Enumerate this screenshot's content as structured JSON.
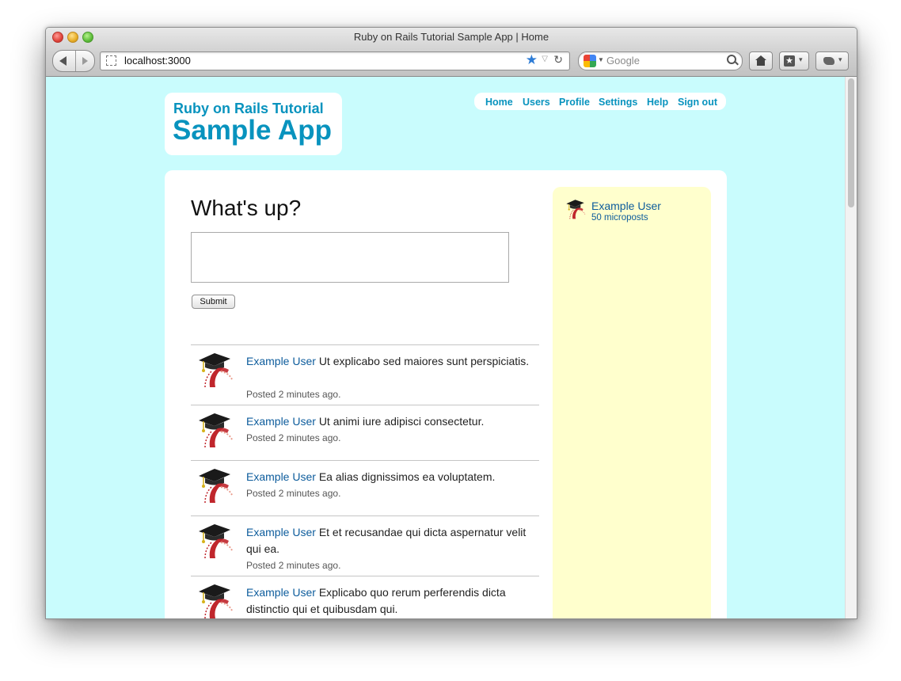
{
  "browser": {
    "window_title": "Ruby on Rails Tutorial Sample App | Home",
    "url": "localhost:3000",
    "search_placeholder": "Google"
  },
  "header": {
    "logo_small": "Ruby on Rails Tutorial",
    "logo_big": "Sample App",
    "nav": [
      "Home",
      "Users",
      "Profile",
      "Settings",
      "Help",
      "Sign out"
    ]
  },
  "compose": {
    "heading": "What's up?",
    "submit_label": "Submit"
  },
  "sidebar": {
    "user_name": "Example User",
    "microposts": "50 microposts"
  },
  "feed": [
    {
      "user": "Example User",
      "content": "Ut explicabo sed maiores sunt perspiciatis.",
      "posted": "Posted 2 minutes ago."
    },
    {
      "user": "Example User",
      "content": "Ut animi iure adipisci consectetur.",
      "posted": "Posted 2 minutes ago."
    },
    {
      "user": "Example User",
      "content": "Ea alias dignissimos ea voluptatem.",
      "posted": "Posted 2 minutes ago."
    },
    {
      "user": "Example User",
      "content": "Et et recusandae qui dicta aspernatur velit qui ea.",
      "posted": "Posted 2 minutes ago."
    },
    {
      "user": "Example User",
      "content": "Explicabo quo rerum perferendis dicta distinctio qui et quibusdam qui.",
      "posted": ""
    }
  ]
}
